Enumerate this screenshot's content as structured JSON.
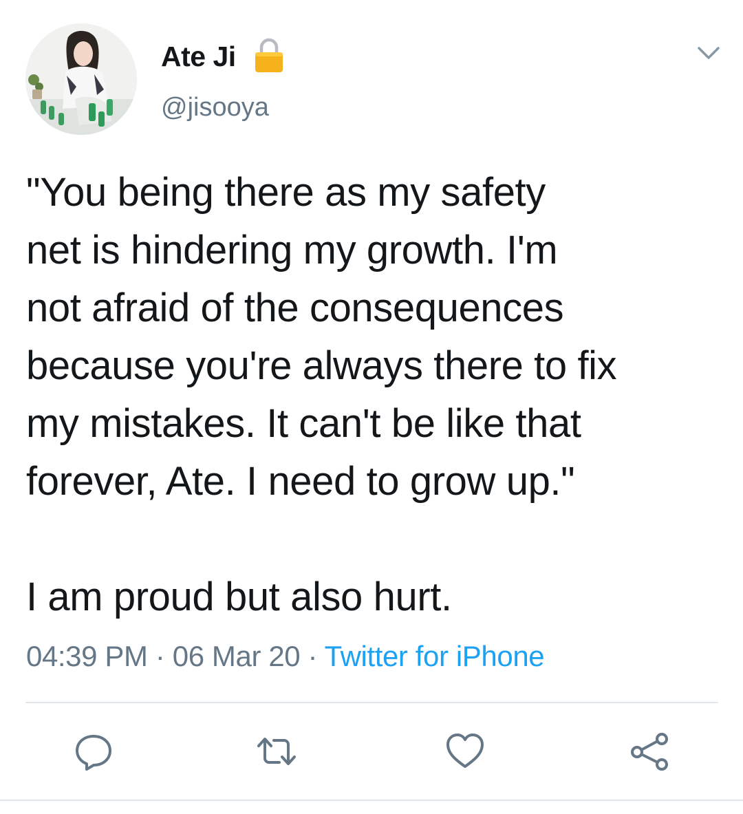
{
  "author": {
    "display_name": "Ate Ji",
    "handle": "@jisooya",
    "protected": true,
    "avatar_icon": "profile-photo"
  },
  "tweet": {
    "text": "\"You being there as my safety\nnet is hindering my growth. I'm\nnot afraid of the consequences\nbecause you're always there to fix\nmy mistakes. It can't be like that\nforever, Ate. I need to grow up.\"\n\nI am proud but also hurt.",
    "time": "04:39 PM",
    "separator": "·",
    "date": "06 Mar 20",
    "source": "Twitter for iPhone"
  },
  "icons": {
    "menu": "chevron-down-icon",
    "lock": "lock-icon",
    "reply": "reply-icon",
    "retweet": "retweet-icon",
    "like": "heart-icon",
    "share": "share-icon"
  },
  "colors": {
    "text": "#14171a",
    "secondary": "#657786",
    "link": "#1da1f2",
    "lock": "#f5b21a",
    "divider": "#e1e8ed"
  }
}
